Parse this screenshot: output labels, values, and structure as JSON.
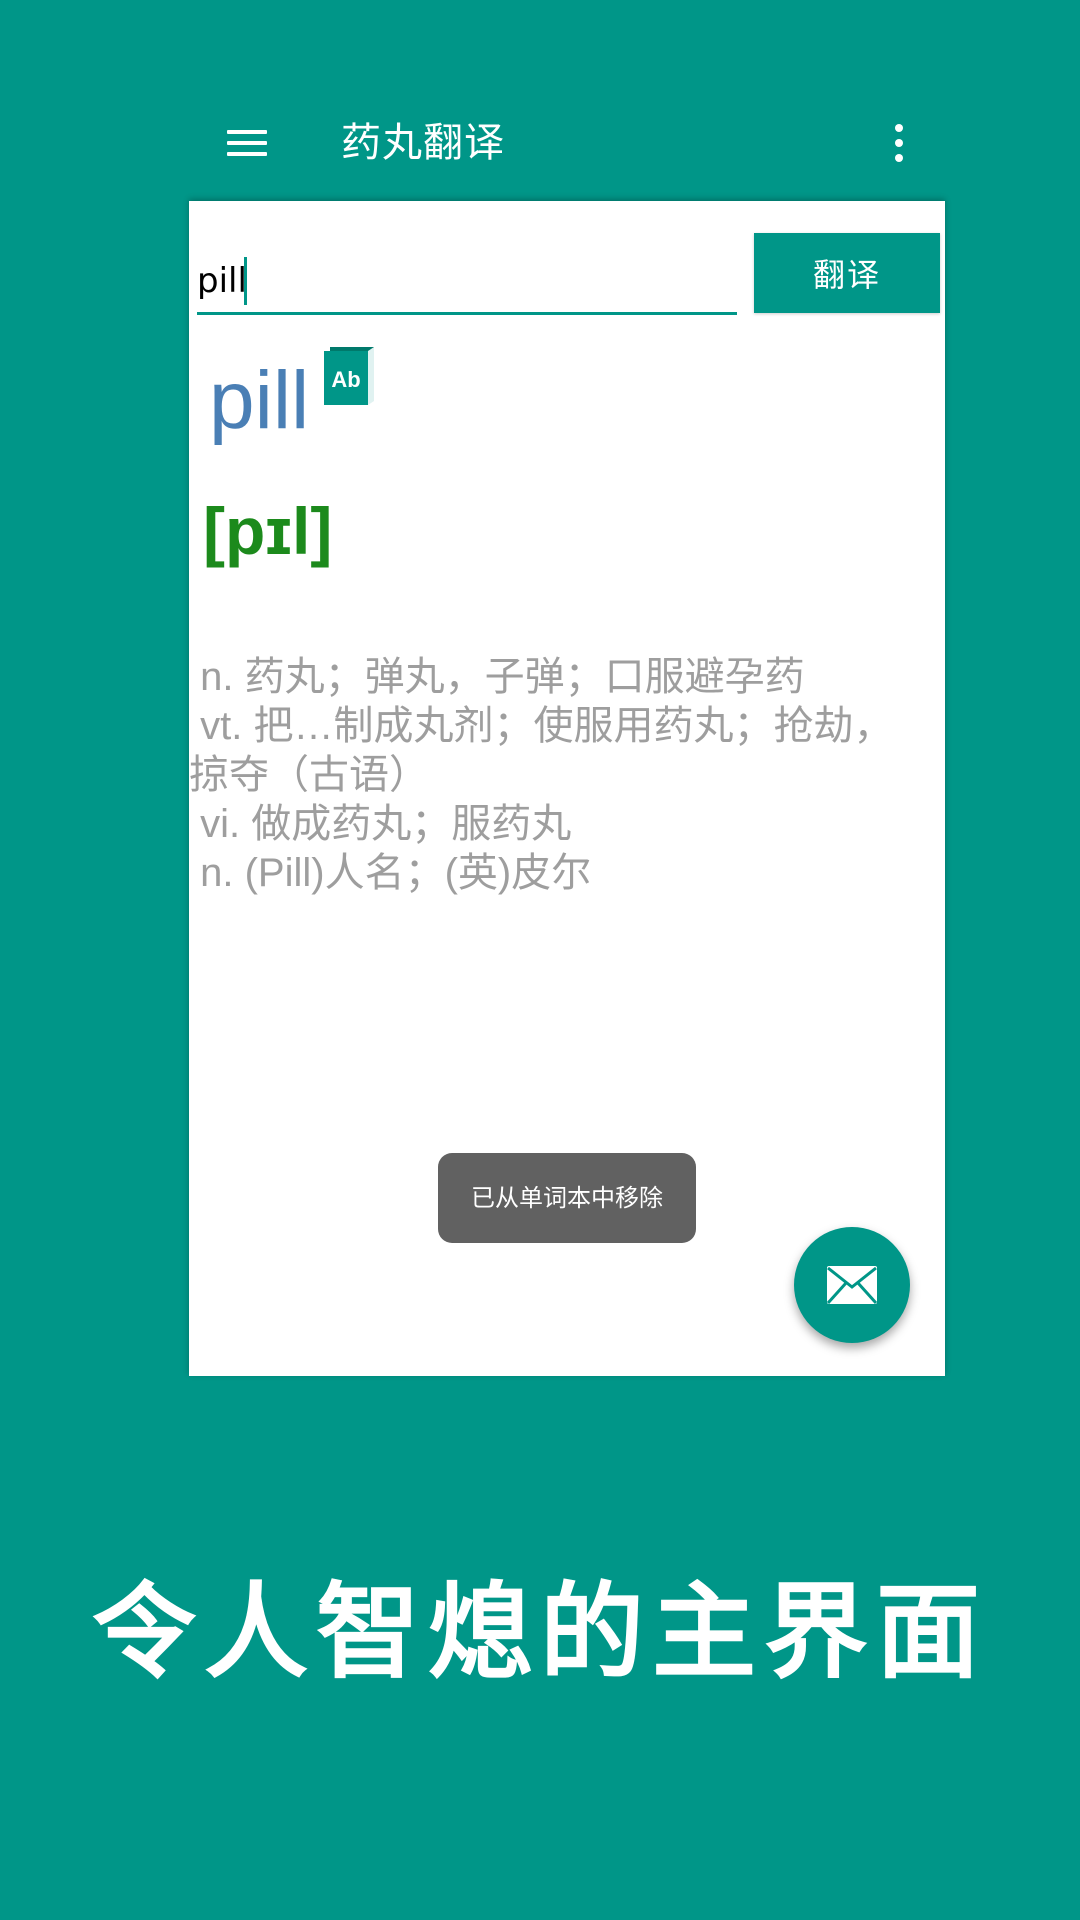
{
  "appbar": {
    "menu_icon": "hamburger-menu-icon",
    "title": "药丸翻译",
    "more_icon": "more-vert-icon"
  },
  "search": {
    "value": "pill",
    "button_label": "翻译"
  },
  "entry": {
    "headword": "pill",
    "dict_icon": "ab-book-icon",
    "dict_icon_text": "Ab",
    "phonetic": "[pɪl]",
    "definitions": [
      " n. 药丸；弹丸，子弹；口服避孕药",
      " vt. 把…制成丸剂；使服用药丸；抢劫，",
      "掠夺（古语）",
      " vi. 做成药丸；服药丸",
      " n. (Pill)人名；(英)皮尔"
    ]
  },
  "toast": {
    "message": "已从单词本中移除"
  },
  "fab": {
    "icon": "mail-icon"
  },
  "caption": "令人智熄的主界面",
  "colors": {
    "primary": "#009688",
    "headword": "#4a7fb5",
    "phonetic": "#1c8a1c",
    "definition_text": "#9e9e9e",
    "toast_bg": "#616161"
  }
}
